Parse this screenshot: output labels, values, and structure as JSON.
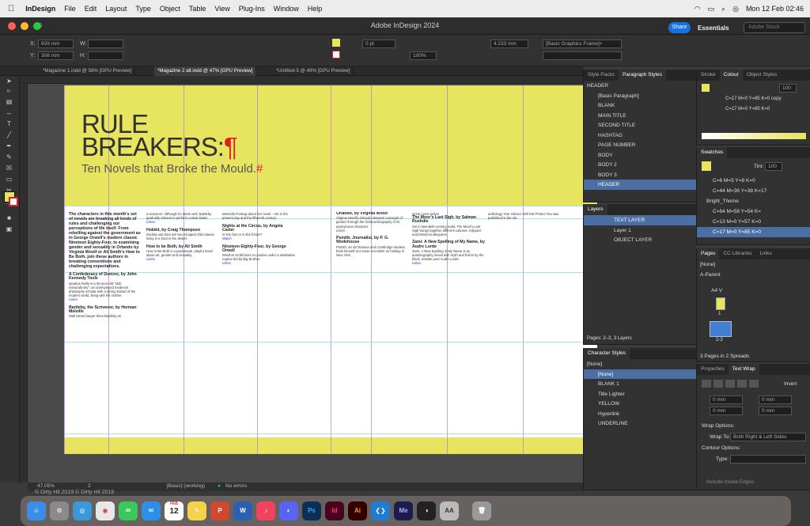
{
  "menubar": {
    "app": "InDesign",
    "items": [
      "File",
      "Edit",
      "Layout",
      "Type",
      "Object",
      "Table",
      "View",
      "Plug-Ins",
      "Window",
      "Help"
    ],
    "datetime": "Mon 12 Feb  02:46"
  },
  "window": {
    "title": "Adobe InDesign 2024"
  },
  "topbar": {
    "share": "Share",
    "workspace": "Essentials",
    "stock_placeholder": "Adobe Stock"
  },
  "control": {
    "x_label": "X:",
    "x_value": "609 mm",
    "y_label": "Y:",
    "y_value": "306 mm",
    "w_label": "W:",
    "h_label": "H:",
    "stroke_weight": "0 pt",
    "opacity": "100%",
    "size": "4.233 mm",
    "frame_style": "[Basic Graphics Frame]+"
  },
  "doc_tabs": [
    "*Magazine 1.indd @ 58% [GPU Preview]",
    "*Magazine 2 alt.indd @ 47% [GPU Preview]",
    "*Untitled-5 @ 49% [GPU Preview]"
  ],
  "spread": {
    "headline_1": "RULE",
    "headline_2": "BREAKERS:",
    "pilcrow": "¶",
    "subhead": "Ten Novels that Broke the Mould.",
    "subhead_mark": "#",
    "columns": [
      {
        "items": [
          "The characters in this month's set of novels are breaking all kinds of rules and challenging our perceptions of life itself. From rebelling against the government as in George Orwell's modern classic Nineteen Eighty-Four, to examining gender and sexuality in Orlando by Virginia Woolf or Ali Smith's How to Be Both, join these authors in breaking conventions and challenging expectations.",
          "A Confederacy of Dunces, by John Kennedy Toole",
          "Ignatius Reilly is a 30-year-old \"slob extraordinary\": an unemployed medieval philosophy scholar with a strong hatred of the modern world, living with his mother.",
          "Listen",
          "Bartleby, the Scrivener, by Herman Melville",
          "Wall Street lawyer hires Bartleby as"
        ]
      },
      {
        "items": [
          "a scrivener. Although he starts well, Bartleby gradually refuses to perform certain tasks.",
          "Listen",
          "Hobbit, by Craig Thompson",
          "Dodola and Zam are two escaped child slaves living in a boat in the desert.",
          "How to be Both, by Ali Smith",
          "How to Be Both is a passionate, playful novel about art, gender and sexuality.",
          "Listen"
        ]
      },
      {
        "items": [
          "Marcella Frostup about her novel – set in the present day and the fifteenth century.",
          "Nights at the Circus, by Angela Carter",
          "Is she fact or is she fiction?",
          "Watch",
          "Nineteen Eighty-Four, by George Orwell",
          "Winston Smith lives in London under a totalitarian regime led by Big Brother.",
          "Listen"
        ]
      },
      {
        "items": [
          "Orlando, by Virginia Woolf",
          "Virginia Woolf's Orlando skewers concepts of gender through the fictional biography of its eponymous character.",
          "Listen",
          "Psmith, Journalist, by P. G. Wodehouse",
          "Psmith, an old Etonian and Cambridge student, finds himself at a loose end while on holiday in New York."
        ]
      },
      {
        "items": [
          "Great Lives series",
          "The Moor's Last Sigh, by Salman Rushdie",
          "Set in twentieth-century India, The Moor's Last Sigh brings together different cultures, religions and historical allegories.",
          "Zami: A New Spelling of My Name, by Audre Lorde",
          "Zami: A New Spelling of My Name is an autobiography mixed with myth and fiction by the black, lesbian poet Audre Lorde.",
          "Listen"
        ]
      },
      {
        "items": [
          "anthology Your Silence Will Not Protect You was published in the UK."
        ]
      }
    ]
  },
  "status": {
    "zoom": "47.05%",
    "page": "2",
    "style": "[Basic] (working)",
    "errors": "No errors"
  },
  "paragraph_styles": {
    "tabs": [
      "Style Packs",
      "Paragraph Styles"
    ],
    "current": "HEADER",
    "items": [
      "[Basic Paragraph]",
      "BLANK",
      "MAIN TITLE",
      "SECOND TITLE",
      "HASHTAG",
      "PAGE NUMBER",
      "BODY",
      "BODY 2",
      "BODY 3",
      "HEADER"
    ]
  },
  "layers": {
    "title": "Layers",
    "items": [
      "TEXT LAYER",
      "Layer 1",
      "OBJECT LAYER"
    ],
    "footer": "Pages: 2–3, 3 Layers"
  },
  "character_styles": {
    "title": "Character Styles",
    "current": "[None]",
    "items": [
      "[None]",
      "BLANK 1",
      "Title Lighter",
      "YELLOW",
      "Hyperlink",
      "UNDERLINE"
    ]
  },
  "colour": {
    "tabs": [
      "Stroke",
      "Colour",
      "Object Styles"
    ],
    "tint": "100",
    "swatch_1": "C=17 M=0 Y=85 K=0 copy",
    "swatch_2": "C=17 M=0 Y=85 K=0"
  },
  "swatches": {
    "title": "Swatches",
    "tint_label": "Tint:",
    "tint": "100",
    "items": [
      "C=6 M=5 Y=8 K=0",
      "C=44 M=36 Y=38 K=17",
      "Bright_Theme",
      "C=64 M=58 Y=54 K=",
      "C=13 M=0 Y=57 K=0",
      "C=17 M=0 Y=85 K=0"
    ]
  },
  "pages": {
    "tabs": [
      "Pages",
      "CC Libraries",
      "Links"
    ],
    "none": "[None]",
    "master": "A-Parent",
    "size": "A4 V",
    "page_1": "1",
    "spread_label": "2-3",
    "footer": "3 Pages in 2 Spreads"
  },
  "text_wrap": {
    "tabs": [
      "Properties",
      "Text Wrap"
    ],
    "invert": "Invert",
    "offset": "0 mm",
    "wrap_options": "Wrap Options:",
    "wrap_to_label": "Wrap To:",
    "wrap_to": "Both Right & Left Sides",
    "contour_options": "Contour Options:",
    "type_label": "Type:",
    "include_inside_edges": "Include Inside Edges"
  },
  "watermark": "© Dirty Hil 2019 © Dirty Hil 2019",
  "dock": {
    "apps": [
      "Finder",
      "Launchpad",
      "Safari",
      "Chrome",
      "Messages",
      "Mail",
      "Calendar",
      "Notes",
      "PowerPoint",
      "Word",
      "Music",
      "Discord",
      "Photoshop",
      "InDesign",
      "Illustrator",
      "VS Code",
      "Media Encoder",
      "Generic",
      "Font Book",
      "Trash"
    ],
    "calendar_date": "12",
    "calendar_month": "FEB",
    "mail_badge": "6"
  },
  "colors": {
    "yellow": "#e7e45f",
    "accent": "#1473e6",
    "pilcrow": "#e02020",
    "selected_row": "#4b6fa3"
  }
}
